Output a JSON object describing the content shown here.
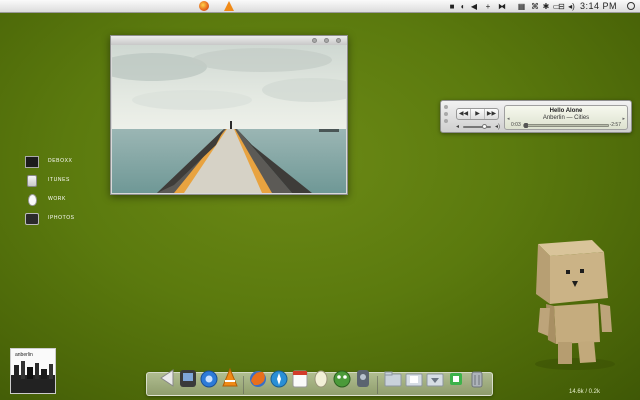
{
  "menubar": {
    "apple_glyph": "",
    "app_icons": [
      "firefox-icon",
      "vlc-icon"
    ],
    "status_items": [
      "■",
      "◐",
      "◀",
      "+",
      "⧓",
      "▦",
      "⌘",
      "✱",
      "▭",
      "⊟",
      "◂)"
    ],
    "clock": "3:14 PM"
  },
  "itunes": {
    "title": "Hello Alone",
    "artist": "Anberlin — Cities",
    "elapsed": "0:03",
    "remaining": "-2:57",
    "progress": 0.02,
    "volume": 0.75,
    "buttons": [
      "◀◀",
      "▶",
      "▶▶"
    ]
  },
  "shortcuts": [
    {
      "label": "DEBOXX",
      "icon": "monitor-icon"
    },
    {
      "label": "ITUNES",
      "icon": "ipod-icon"
    },
    {
      "label": "WORK",
      "icon": "mouse-icon"
    },
    {
      "label": "IPHOTOS",
      "icon": "camera-icon"
    }
  ],
  "album": {
    "label": "anberlin"
  },
  "dock": {
    "items": [
      "finder-icon",
      "coda-icon",
      "quicktime-icon",
      "vlc-icon",
      "firefox-icon",
      "safari-icon",
      "ical-icon",
      "address-book-icon",
      "game-icon",
      "system-preferences-icon",
      "applications-folder-icon",
      "documents-folder-icon",
      "downloads-folder-icon",
      "utorrent-icon",
      "trash-icon"
    ]
  },
  "netspeed": "14.6k / 0.2k",
  "colors": {
    "desktop": "#5b7a0e",
    "accent_orange": "#e5631a"
  }
}
